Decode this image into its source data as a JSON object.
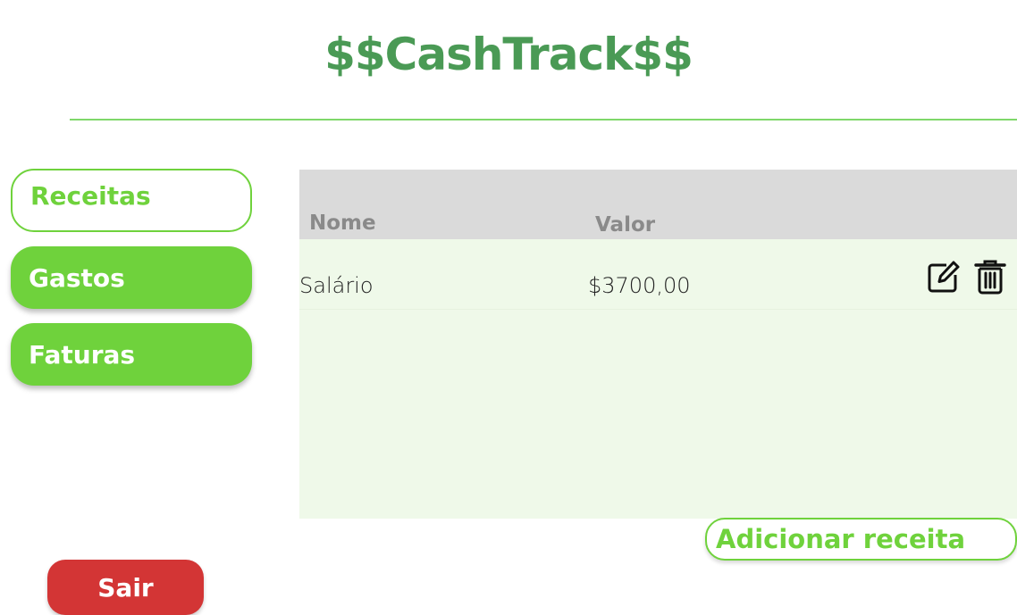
{
  "header": {
    "title": "$$CashTrack$$"
  },
  "sidebar": {
    "items": [
      {
        "label": "Receitas",
        "active": true
      },
      {
        "label": "Gastos",
        "active": false
      },
      {
        "label": "Faturas",
        "active": false
      }
    ]
  },
  "table": {
    "columns": [
      "Nome",
      "Valor"
    ],
    "rows": [
      {
        "nome": "Salário",
        "valor": "$3700,00",
        "actions": [
          "edit-icon",
          "trash-icon"
        ]
      }
    ]
  },
  "actions": {
    "add_label": "Adicionar receita",
    "logout_label": "Sair"
  },
  "colors": {
    "title": "#4a9a55",
    "accent": "#6fd23c",
    "danger": "#d33535",
    "table_header": "#dadada",
    "table_body": "#eff9e9"
  }
}
